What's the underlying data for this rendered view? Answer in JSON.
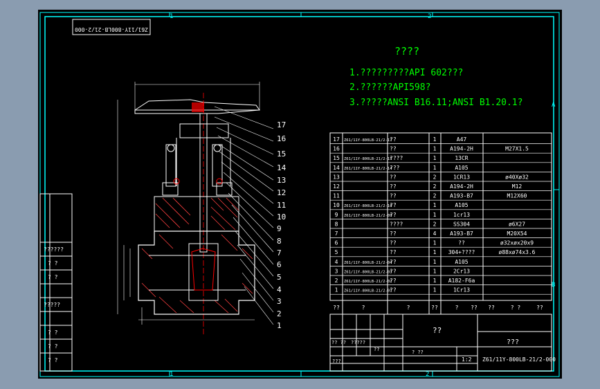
{
  "drawing": {
    "code_box": "Z61/11Y-800LB-21/2-000",
    "zone_top": [
      "1",
      "2"
    ],
    "zone_bottom": [
      "1",
      "2"
    ],
    "zone_right": [
      "A",
      "B"
    ],
    "tech_title": "????",
    "notes": [
      "1.?????????API 602???",
      "2.??????API598?",
      "3.?????ANSI B16.11;ANSI B1.20.1?"
    ],
    "balloons": [
      "17",
      "16",
      "15",
      "14",
      "13",
      "12",
      "11",
      "10",
      "9",
      "8",
      "7",
      "6",
      "5",
      "4",
      "3",
      "2",
      "1"
    ],
    "left_panel": [
      "??????",
      "?  ?",
      "?  ?",
      "?????",
      "?  ?",
      "?  ?",
      "?  ?"
    ],
    "bom": [
      {
        "no": "17",
        "code": "Z61/11Y-800LB-21/2-17",
        "name": "??",
        "qty": "1",
        "mat": "A47",
        "note": ""
      },
      {
        "no": "16",
        "code": "",
        "name": "??",
        "qty": "1",
        "mat": "A194-2H",
        "note": "M27X1.5"
      },
      {
        "no": "15",
        "code": "Z61/11Y-800LB-21/2-15",
        "name": "????",
        "qty": "1",
        "mat": "13CR",
        "note": ""
      },
      {
        "no": "14",
        "code": "Z61/11Y-800LB-21/2-14",
        "name": "???",
        "qty": "1",
        "mat": "A105",
        "note": ""
      },
      {
        "no": "13",
        "code": "",
        "name": "??",
        "qty": "2",
        "mat": "1CR13",
        "note": "ø40Xø32"
      },
      {
        "no": "12",
        "code": "",
        "name": "??",
        "qty": "2",
        "mat": "A194-2H",
        "note": "M12"
      },
      {
        "no": "11",
        "code": "",
        "name": "??",
        "qty": "2",
        "mat": "A193-B7",
        "note": "M12X60"
      },
      {
        "no": "10",
        "code": "Z61/11Y-800LB-21/2-10",
        "name": "??",
        "qty": "1",
        "mat": "A105",
        "note": ""
      },
      {
        "no": "9",
        "code": "Z61/11Y-800LB-21/2-09",
        "name": "??",
        "qty": "1",
        "mat": "1cr13",
        "note": ""
      },
      {
        "no": "8",
        "code": "",
        "name": "????",
        "qty": "2",
        "mat": "SS304",
        "note": "ø6X27"
      },
      {
        "no": "7",
        "code": "",
        "name": "??",
        "qty": "4",
        "mat": "A193-B7",
        "note": "M20X54"
      },
      {
        "no": "6",
        "code": "",
        "name": "??",
        "qty": "1",
        "mat": "??",
        "note": "ø32xøx20x9"
      },
      {
        "no": "5",
        "code": "",
        "name": "??",
        "qty": "1",
        "mat": "304+????",
        "note": "ø88xø74x3.6"
      },
      {
        "no": "4",
        "code": "Z61/11Y-800LB-21/2-04",
        "name": "??",
        "qty": "1",
        "mat": "A105",
        "note": ""
      },
      {
        "no": "3",
        "code": "Z61/11Y-800LB-21/2-03",
        "name": "??",
        "qty": "1",
        "mat": "2Cr13",
        "note": ""
      },
      {
        "no": "2",
        "code": "Z61/11Y-800LB-21/2-02",
        "name": "??",
        "qty": "1",
        "mat": "A182-F6a",
        "note": ""
      },
      {
        "no": "1",
        "code": "Z61/11Y-800LB-21/2-01",
        "name": "??",
        "qty": "1",
        "mat": "1Cr13",
        "note": ""
      }
    ],
    "bom_header": [
      "??",
      "?",
      "?",
      "??",
      "?",
      "??",
      "??",
      "? ?",
      "??"
    ],
    "title_block": {
      "part_name": "??",
      "company": "???",
      "drawing_no": "Z61/11Y-800LB-21/2-000",
      "scale": "1:2",
      "sub_labels": [
        "?? ??",
        "?????",
        "??",
        "???",
        "? ??"
      ]
    }
  }
}
